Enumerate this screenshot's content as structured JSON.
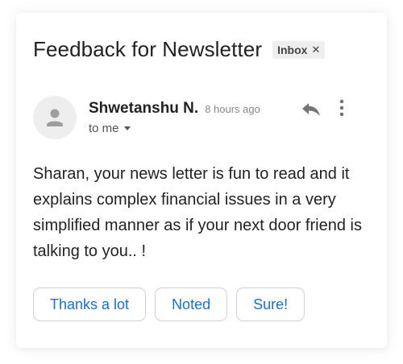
{
  "email": {
    "subject": "Feedback for Newsletter",
    "label": "Inbox",
    "label_remove_icon": "x-icon",
    "sender_name": "Shwetanshu N.",
    "time": "8 hours ago",
    "recipient": "to me",
    "body": "Sharan, your news letter is fun to read and it explains complex financial issues in a very simplified manner as if your next door friend is talking to you.. !"
  },
  "actions": {
    "reply_icon": "reply-icon",
    "more_icon": "more-vertical-icon"
  },
  "smart_replies": [
    "Thanks a lot",
    "Noted",
    "Sure!"
  ],
  "colors": {
    "accent": "#1a6fd1",
    "chip_bg": "#eeeeee",
    "icon_gray": "#757575"
  }
}
